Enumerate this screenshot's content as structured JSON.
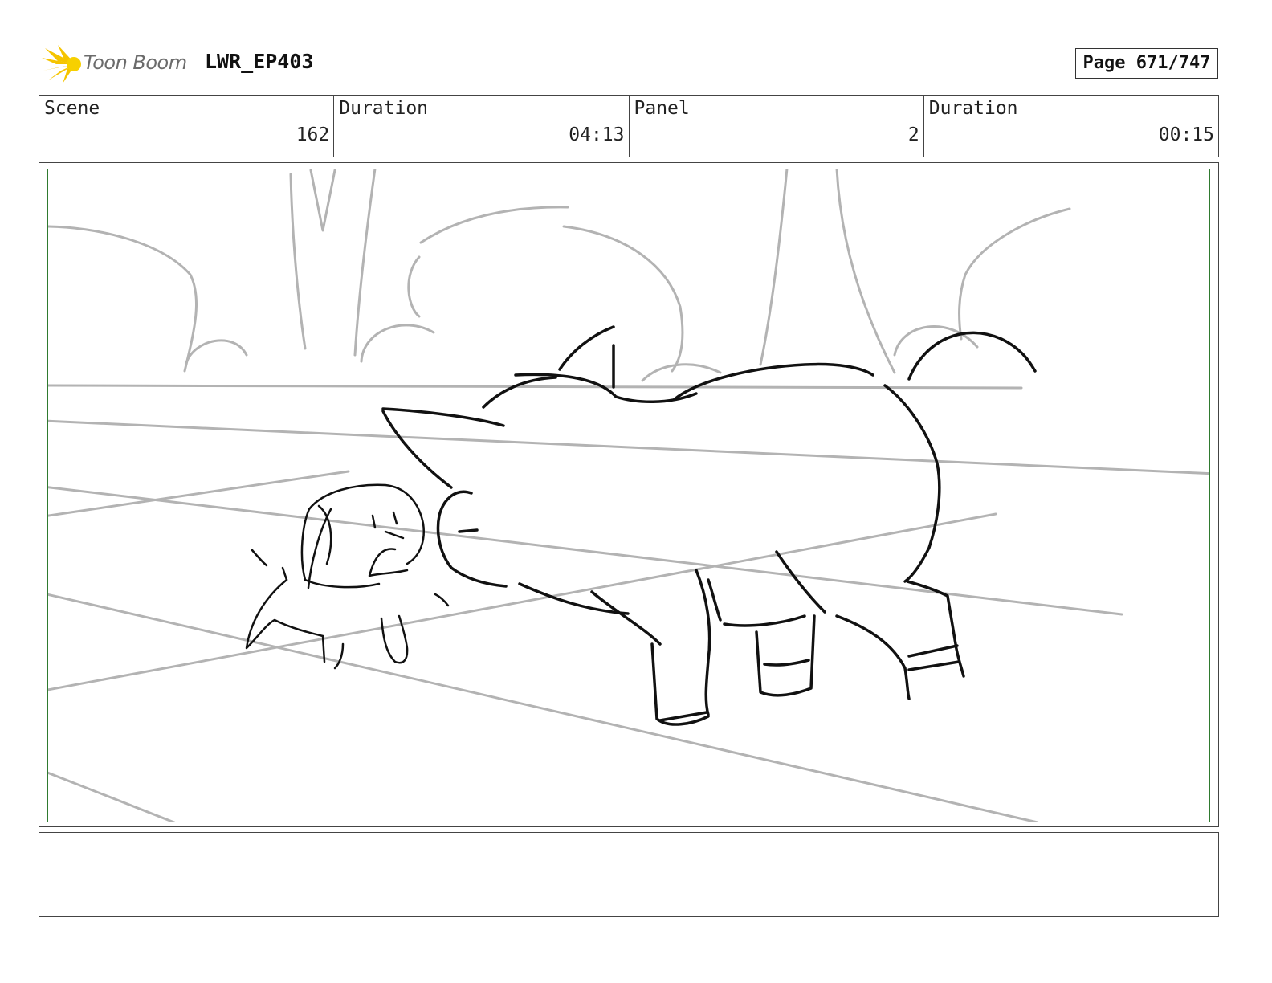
{
  "header": {
    "logo_text": "Toon Boom",
    "project_name": "LWR_EP403",
    "page_label": "Page 671/747"
  },
  "info": [
    {
      "label": "Scene",
      "value": "162"
    },
    {
      "label": "Duration",
      "value": "04:13"
    },
    {
      "label": "Panel",
      "value": "2"
    },
    {
      "label": "Duration",
      "value": "00:15"
    }
  ],
  "colors": {
    "logo_yellow": "#f5c400",
    "panel_border": "#2f7a2f",
    "sketch_ink": "#111111",
    "background_ink": "#b3b3b3"
  },
  "notes": ""
}
